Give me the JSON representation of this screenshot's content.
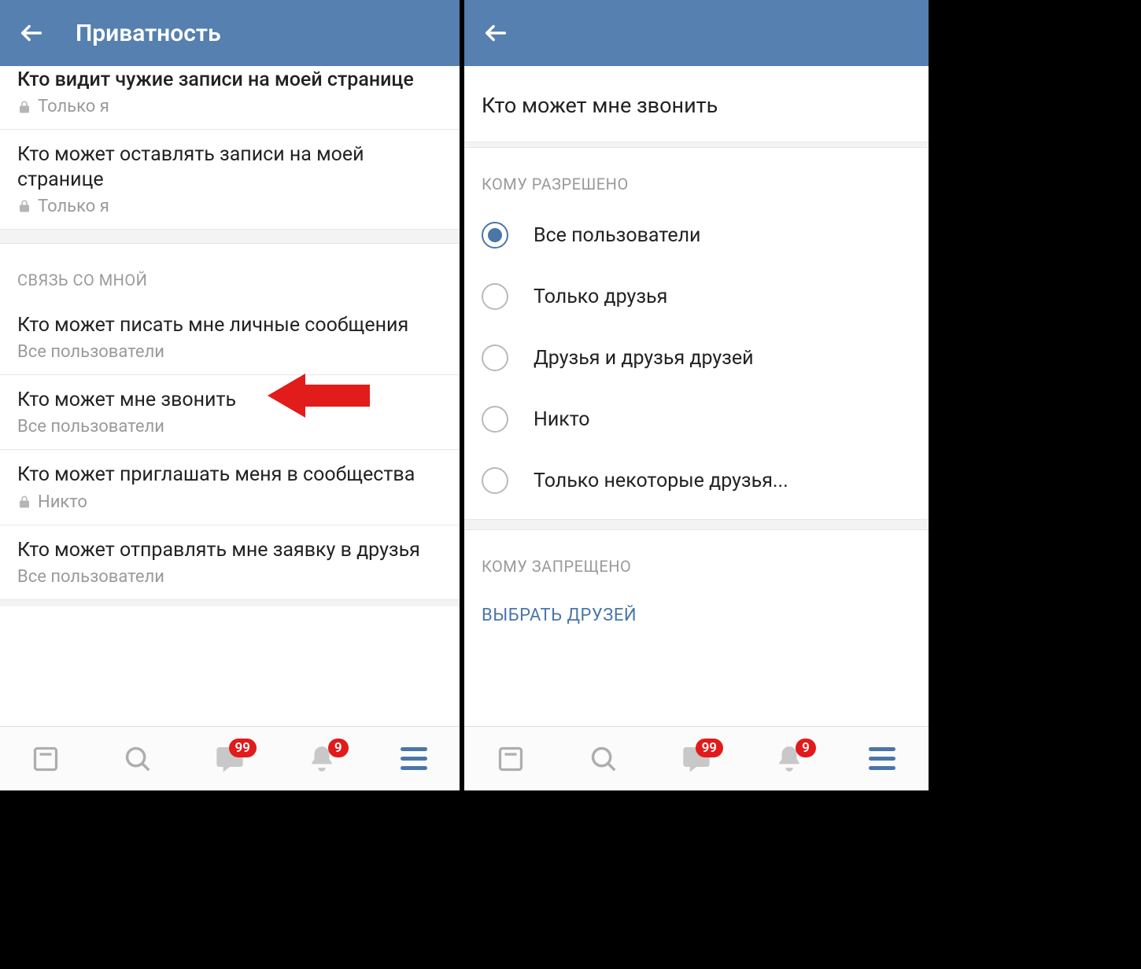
{
  "left": {
    "header_title": "Приватность",
    "rows": {
      "r1": {
        "title": "Кто видит чужие записи на моей странице",
        "value": "Только я"
      },
      "r2": {
        "title": "Кто может оставлять записи на моей странице",
        "value": "Только я"
      }
    },
    "section_contact": "СВЯЗЬ СО МНОЙ",
    "contact_rows": {
      "c1": {
        "title": "Кто может писать мне личные сообщения",
        "value": "Все пользователи"
      },
      "c2": {
        "title": "Кто может мне звонить",
        "value": "Все пользователи"
      },
      "c3": {
        "title": "Кто может приглашать меня в сообщества",
        "value": "Никто"
      },
      "c4": {
        "title": "Кто может отправлять мне заявку в друзья",
        "value": "Все пользователи"
      }
    }
  },
  "right": {
    "page_title": "Кто может мне звонить",
    "allowed_header": "КОМУ РАЗРЕШЕНО",
    "options": {
      "o1": "Все пользователи",
      "o2": "Только друзья",
      "o3": "Друзья и друзья друзей",
      "o4": "Никто",
      "o5": "Только некоторые друзья..."
    },
    "denied_header": "КОМУ ЗАПРЕЩЕНО",
    "choose_friends": "ВЫБРАТЬ ДРУЗЕЙ"
  },
  "tabs": {
    "messages_badge": "99",
    "notifications_badge": "9"
  }
}
